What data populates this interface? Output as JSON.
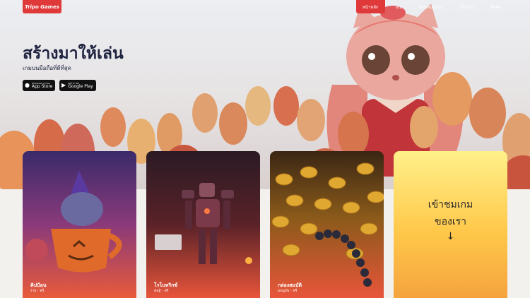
{
  "brand": {
    "logo_text": "Tripo Games"
  },
  "nav": {
    "items": [
      {
        "label": "หน้าหลัก",
        "active": true
      },
      {
        "label": "เกม",
        "active": false
      },
      {
        "label": "ตำแหน่งงาน",
        "active": false
      },
      {
        "label": "เกี่ยวกับ",
        "active": false
      },
      {
        "label": "ติดต่อ",
        "active": false
      }
    ]
  },
  "hero": {
    "title": "สร้างมาให้เล่น",
    "subtitle": "เกมบนมือถือที่ดีที่สุด",
    "app_store": {
      "small": "Download on the",
      "big": "App Store"
    },
    "google_play": {
      "small": "GET IT ON",
      "big": "Google Play"
    }
  },
  "games": [
    {
      "title": "คิปป้อน",
      "meta": "ง่าย - ฟรี"
    },
    {
      "title": "โรโบทริกซ์",
      "meta": "ต่อสู้ - ฟรี"
    },
    {
      "title": "กล่องสมบัติ",
      "meta": "ผจญภัย - ฟรี"
    }
  ],
  "cta": {
    "line1": "เข้าชมเกม",
    "line2": "ของเรา",
    "arrow": "↓"
  },
  "colors": {
    "accent": "#e0393a",
    "title": "#1e2340"
  }
}
